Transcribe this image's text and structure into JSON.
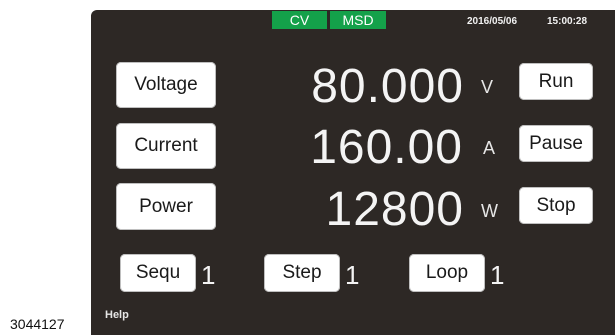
{
  "status": {
    "mode": "CV",
    "source": "MSD"
  },
  "datetime": {
    "date": "2016/05/06",
    "time": "15:00:28"
  },
  "measurements": {
    "voltage": {
      "label": "Voltage",
      "value": "80.000",
      "unit": "V"
    },
    "current": {
      "label": "Current",
      "value": "160.00",
      "unit": "A"
    },
    "power": {
      "label": "Power",
      "value": "12800",
      "unit": "W"
    }
  },
  "controls": {
    "run": "Run",
    "pause": "Pause",
    "stop": "Stop"
  },
  "sequence": {
    "sequ": {
      "label": "Sequ",
      "value": "1"
    },
    "step": {
      "label": "Step",
      "value": "1"
    },
    "loop": {
      "label": "Loop",
      "value": "1"
    }
  },
  "footer": {
    "help": "Help"
  },
  "figure_id": "3044127",
  "colors": {
    "screen_bg": "#2d2825",
    "badge_green": "#14a14a",
    "button_bg": "#ffffff",
    "text_light": "#f4f4f4"
  }
}
